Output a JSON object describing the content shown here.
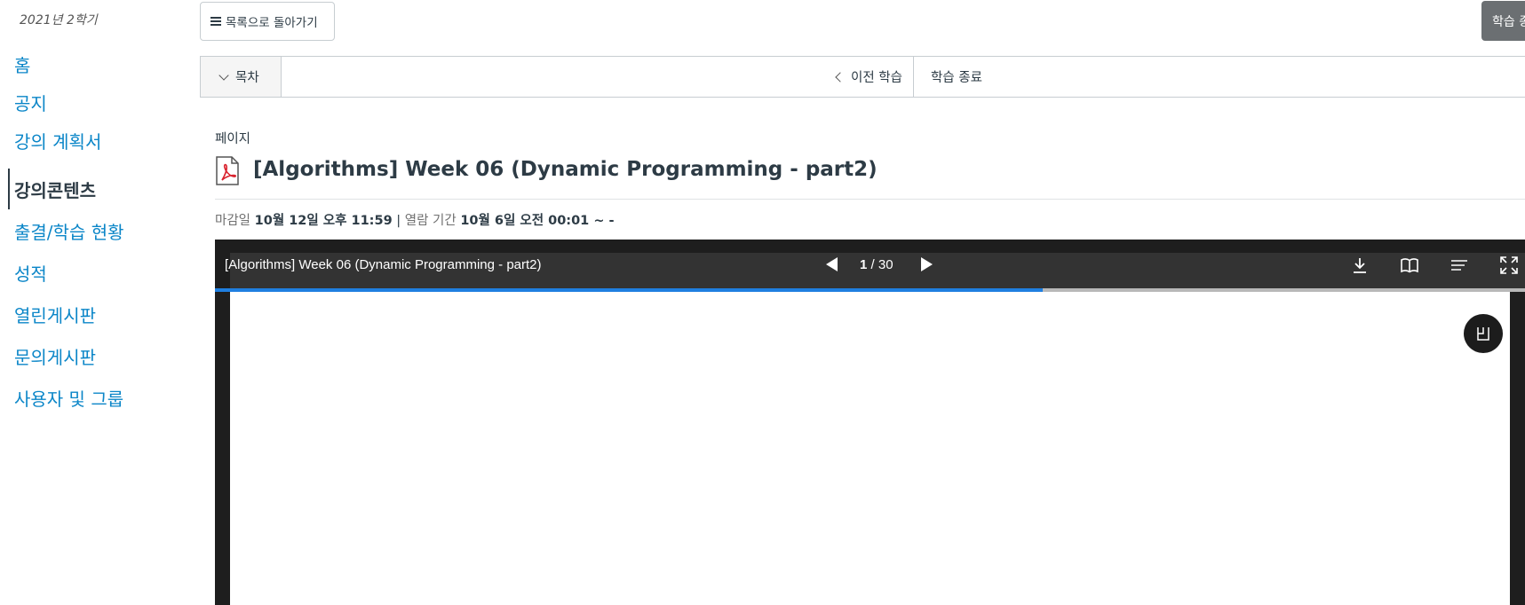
{
  "sidebar": {
    "term": "2021년 2학기",
    "items": [
      {
        "label": "홈"
      },
      {
        "label": "공지"
      },
      {
        "label": "강의 계획서"
      },
      {
        "label": "강의콘텐츠"
      },
      {
        "label": "출결/학습 현황"
      },
      {
        "label": "성적"
      },
      {
        "label": "열린게시판"
      },
      {
        "label": "문의게시판"
      },
      {
        "label": "사용자 및 그룹"
      }
    ],
    "active_index": 3
  },
  "top": {
    "back_label": "목록으로 돌아가기",
    "end_label": "학습 종료"
  },
  "navbar": {
    "toc_label": "목차",
    "prev_label": "이전 학습",
    "end_label": "학습 종료"
  },
  "content": {
    "kind": "페이지",
    "title": "[Algorithms] Week 06 (Dynamic Programming - part2)",
    "deadline_label": "마감일",
    "deadline_value": "10월 12일 오후 11:59",
    "separator": "|",
    "period_label": "열람 기간",
    "period_value": "10월 6일 오전 00:01 ~ -"
  },
  "viewer": {
    "doc_title": "[Algorithms] Week 06 (Dynamic Programming - part2)",
    "current_page": "1",
    "page_sep": " / ",
    "total_pages": "30",
    "progress_fraction": 0.63,
    "icons": [
      "download-icon",
      "book-view-icon",
      "outline-icon",
      "fullscreen-icon"
    ],
    "floating_icon": "hand-tool-icon"
  },
  "colors": {
    "link": "#0b86c8",
    "text": "#2d3b45",
    "viewer_bg": "#1e1e1e",
    "toolbar_bg": "#333333",
    "progress": "#1f7fe0",
    "pdf_red": "#d9232e"
  }
}
